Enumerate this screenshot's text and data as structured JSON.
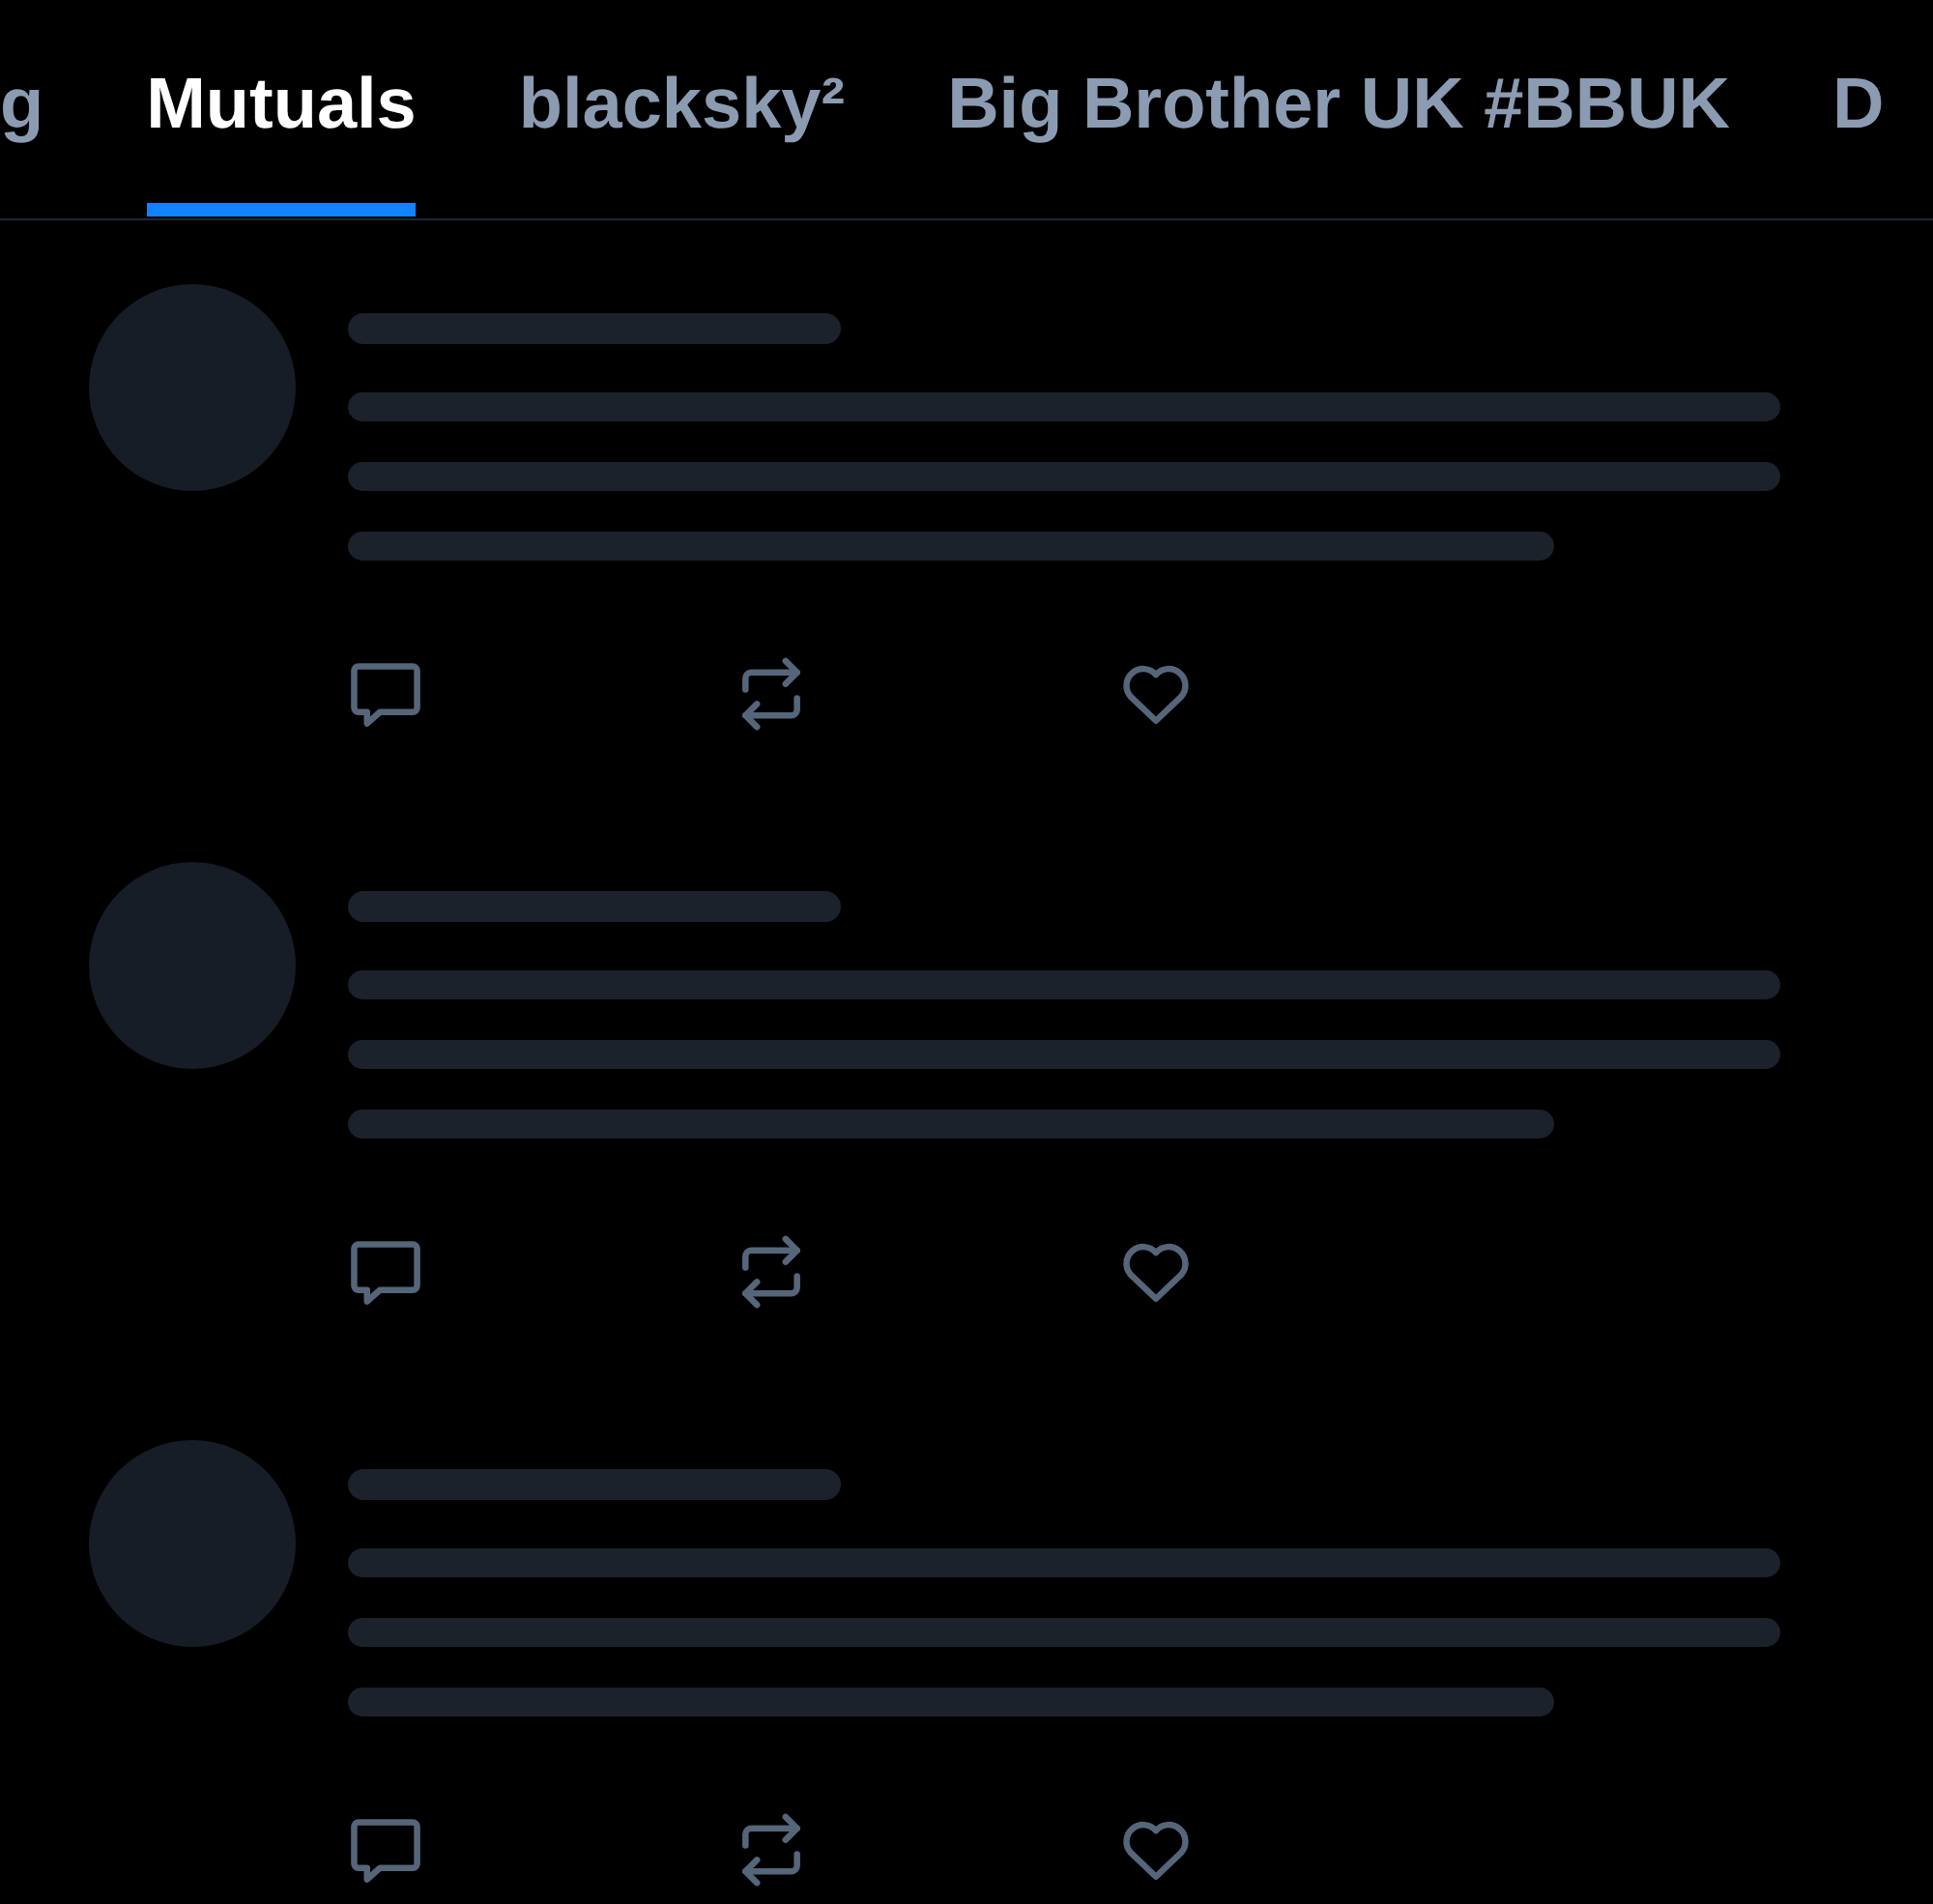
{
  "tabs": [
    {
      "label": "g",
      "selected": false
    },
    {
      "label": "Mutuals",
      "selected": true
    },
    {
      "label": "blacksky²",
      "selected": false
    },
    {
      "label": "Big Brother UK #BBUK",
      "selected": false
    },
    {
      "label": "D",
      "selected": false
    }
  ],
  "feed": {
    "posts": [
      {
        "kind": "skeleton"
      },
      {
        "kind": "skeleton"
      },
      {
        "kind": "skeleton"
      }
    ]
  }
}
